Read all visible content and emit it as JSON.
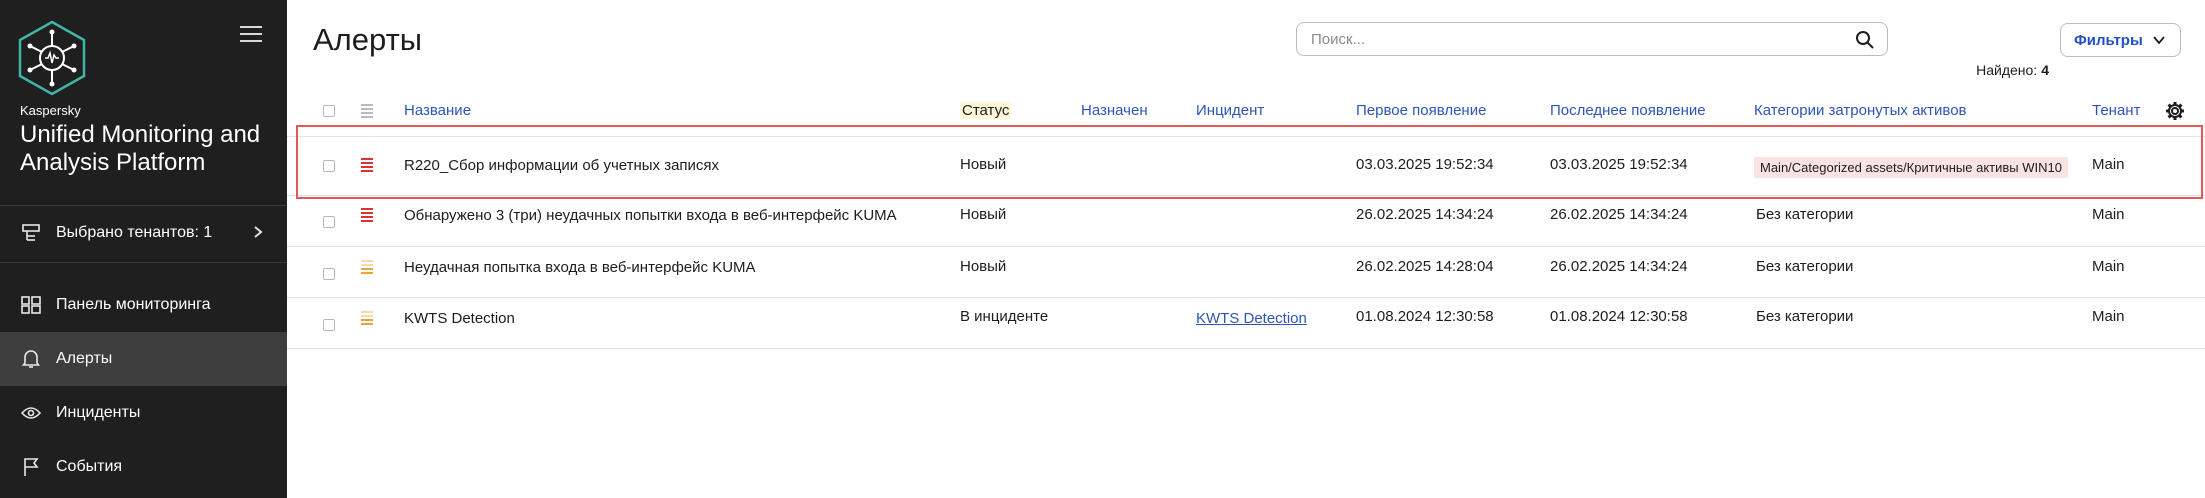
{
  "sidebar": {
    "brand_small": "Kaspersky",
    "brand_title": "Unified Monitoring and Analysis Platform",
    "tenant_label": "Выбрано тенантов: 1",
    "nav": [
      {
        "label": "Панель мониторинга",
        "icon": "dashboard-icon"
      },
      {
        "label": "Алерты",
        "icon": "bell-icon"
      },
      {
        "label": "Инциденты",
        "icon": "eye-icon"
      },
      {
        "label": "События",
        "icon": "flag-icon"
      }
    ],
    "active": "Алерты"
  },
  "header": {
    "title": "Алерты",
    "search_placeholder": "Поиск...",
    "filters_label": "Фильтры",
    "found_label": "Найдено:",
    "found_count": "4"
  },
  "table": {
    "columns": [
      "Название",
      "Статус",
      "Назначен",
      "Инцидент",
      "Первое появление",
      "Последнее появление",
      "Категории затронутых активов",
      "Тенант"
    ],
    "rows": [
      {
        "severity": "high",
        "name": "R220_Сбор информации об учетных записях",
        "status": "Новый",
        "assigned": "",
        "incident": "",
        "first": "03.03.2025 19:52:34",
        "last": "03.03.2025 19:52:34",
        "category": "Main/Categorized assets/Критичные активы WIN10",
        "tenant": "Main"
      },
      {
        "severity": "high",
        "name": "Обнаружено 3 (три) неудачных попытки входа в веб-интерфейс KUMA",
        "status": "Новый",
        "assigned": "",
        "incident": "",
        "first": "26.02.2025 14:34:24",
        "last": "26.02.2025 14:34:24",
        "category": "Без категории",
        "tenant": "Main"
      },
      {
        "severity": "medium",
        "name": "Неудачная попытка входа в веб-интерфейс KUMA",
        "status": "Новый",
        "assigned": "",
        "incident": "",
        "first": "26.02.2025 14:28:04",
        "last": "26.02.2025 14:34:24",
        "category": "Без категории",
        "tenant": "Main"
      },
      {
        "severity": "medium",
        "name": "KWTS Detection",
        "status": "В инциденте",
        "assigned": "",
        "incident": "KWTS Detection",
        "first": "01.08.2024 12:30:58",
        "last": "01.08.2024 12:30:58",
        "category": "Без категории",
        "tenant": "Main"
      }
    ]
  },
  "colors": {
    "sidebar_bg": "#1f1f1f",
    "active_nav": "#3e3e3e",
    "link": "#2d56b8",
    "severity_high": "#d93434",
    "severity_medium": "#f0a23a",
    "highlight": "#e05858",
    "logo": "#3fb6a8"
  }
}
